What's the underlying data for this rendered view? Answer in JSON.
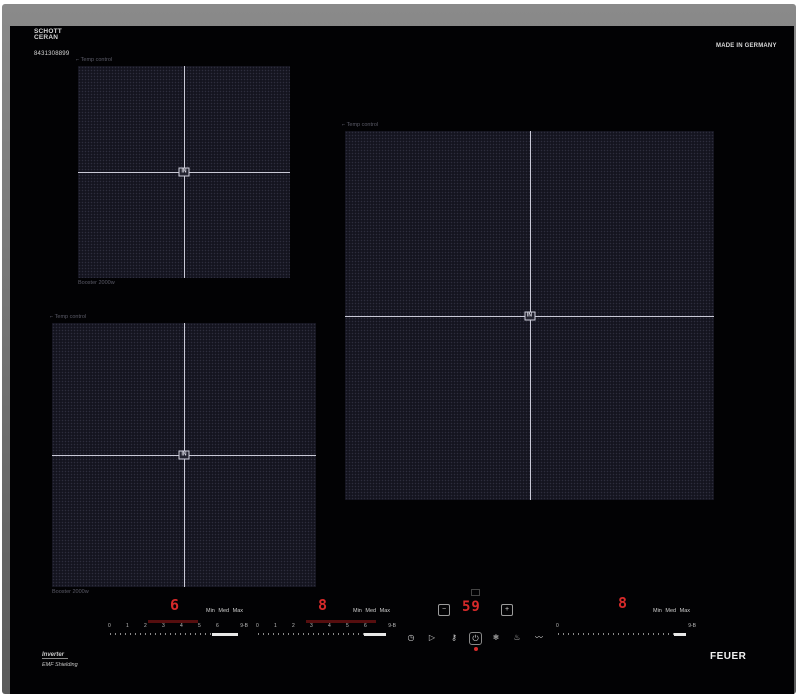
{
  "brand": {
    "schott_line1": "SCHOTT",
    "schott_line2": "CERAN",
    "serial": "8431308899",
    "made_in": "MADE IN GERMANY",
    "feuer": "FEUER"
  },
  "zones": [
    {
      "temp_label": "Temp control",
      "in_label": "IN",
      "booster_label": "Booster 2000w"
    },
    {
      "temp_label": "Temp control",
      "in_label": "IN",
      "booster_label": ""
    },
    {
      "temp_label": "Temp control",
      "in_label": "IN",
      "booster_label": "Booster 2000w"
    }
  ],
  "displays": {
    "left_digit": "6",
    "mid_digit": "8",
    "timer_value": "59",
    "right_digit": "8"
  },
  "scale": {
    "min": "Min",
    "med": "Med",
    "max": "Max"
  },
  "sliders": {
    "start": "0",
    "tick_1": "1",
    "tick_2": "2",
    "tick_3": "3",
    "tick_4": "4",
    "tick_5": "5",
    "tick_6": "6",
    "end": "9-B"
  },
  "timer": {
    "minus": "−",
    "plus": "+"
  },
  "controls": {
    "icons": [
      "timer-icon",
      "play-icon",
      "key-lock-icon",
      "power-icon",
      "snowflake-icon",
      "heat-icon",
      "wave-icon"
    ]
  },
  "inverter": {
    "logo": "Inverter",
    "subtitle": "EMF Shielding"
  },
  "colors": {
    "glass": "#020204",
    "display_red": "#d62a2a",
    "zone_grid": "#14141f"
  }
}
